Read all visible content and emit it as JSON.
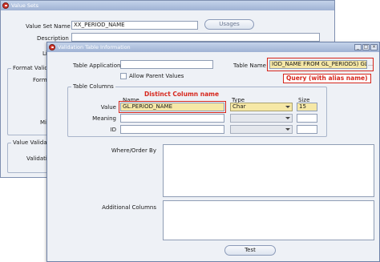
{
  "back_window": {
    "title": "Value Sets",
    "value_set_name_label": "Value Set Name",
    "value_set_name_value": "XX_PERIOD_NAME",
    "usages_button": "Usages",
    "description_label": "Description",
    "list_type_label": "Li",
    "format_validation_label": "Format Valid",
    "format_type_label": "Form",
    "maximum_label": "Mi",
    "value_validation_label": "Value Valida",
    "validation_type_label": "Validati"
  },
  "dialog": {
    "title": "Validation Table Information",
    "table_application_label": "Table Application",
    "table_application_value": "",
    "allow_parent_values_label": "Allow Parent Values",
    "allow_parent_values_checked": false,
    "table_name_label": "Table Name",
    "table_name_value": "IOD_NAME FROM GL_PERIODS) GL",
    "table_columns_group": "Table Columns",
    "col_header_name": "Name",
    "col_header_type": "Type",
    "col_header_size": "Size",
    "rows": [
      {
        "label": "Value",
        "name": "GL.PERIOD_NAME",
        "type": "Char",
        "size": "15"
      },
      {
        "label": "Meaning",
        "name": "",
        "type": "",
        "size": ""
      },
      {
        "label": "ID",
        "name": "",
        "type": "",
        "size": ""
      }
    ],
    "where_order_by_label": "Where/Order By",
    "where_order_by_value": "",
    "additional_columns_label": "Additional Columns",
    "additional_columns_value": "",
    "test_button": "Test"
  },
  "annotations": {
    "distinct_column": "Distinct Column name",
    "query_alias": "Query (with alias name)"
  },
  "colors": {
    "highlight_field": "#f6e8a6",
    "annotation_red": "#d6261c",
    "dialog_bg": "#eef1f6",
    "titlebar": "#a7b8d8"
  }
}
